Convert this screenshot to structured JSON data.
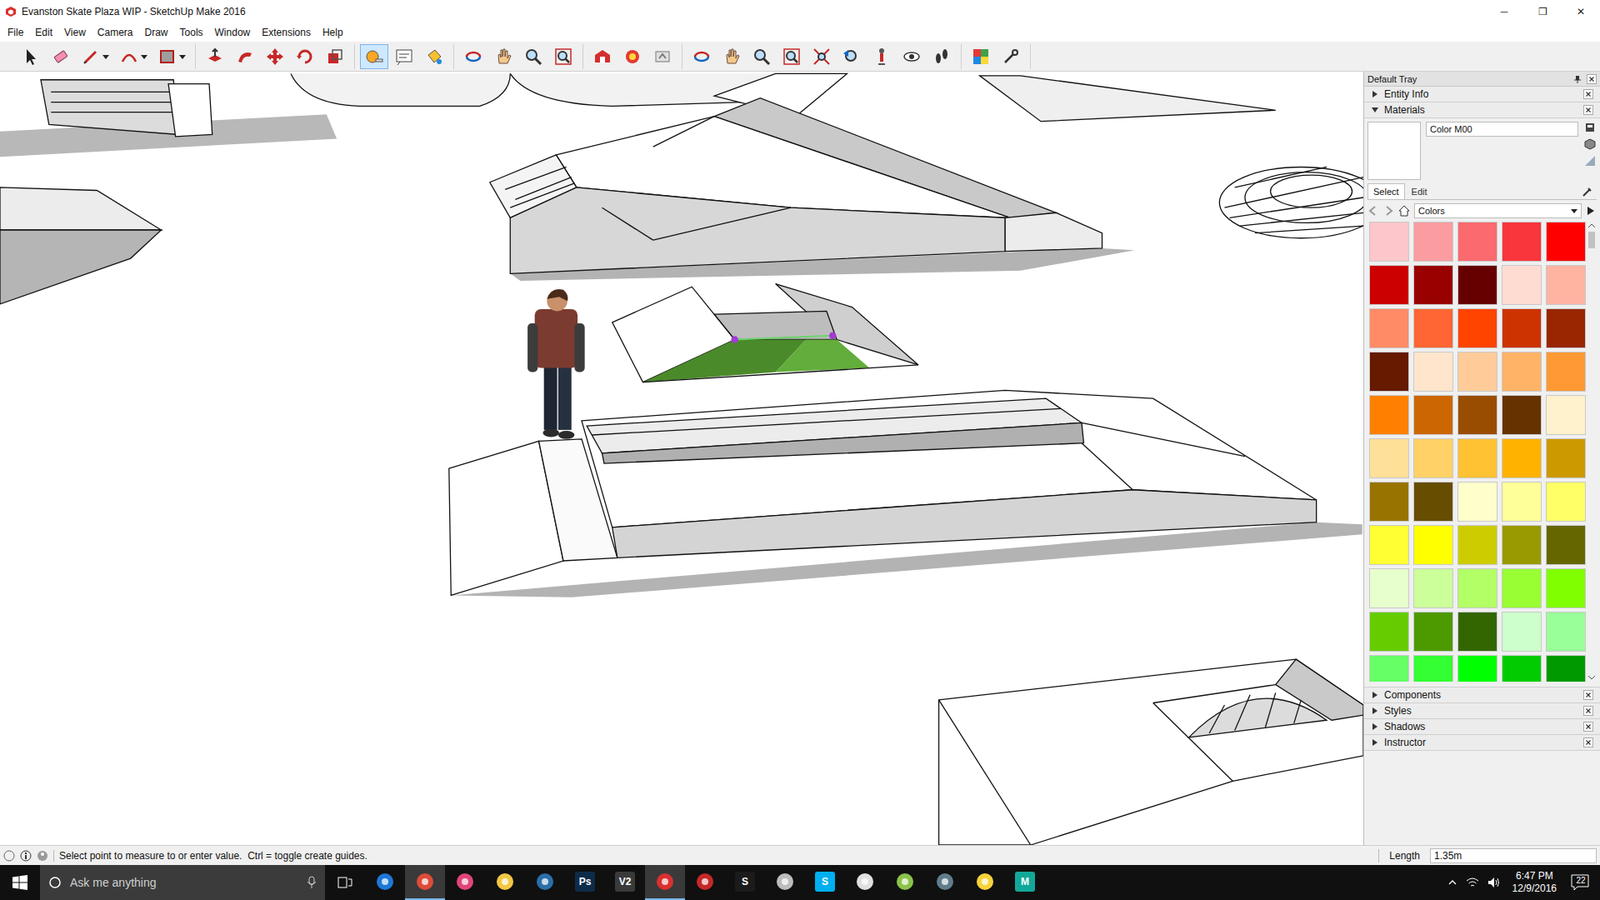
{
  "window": {
    "title": "Evanston Skate Plaza WIP - SketchUp Make 2016",
    "controls": [
      "─",
      "❐",
      "✕"
    ]
  },
  "menu": [
    "File",
    "Edit",
    "View",
    "Camera",
    "Draw",
    "Tools",
    "Window",
    "Extensions",
    "Help"
  ],
  "toolbar": [
    [
      {
        "kind": "select",
        "selected": false,
        "menu": false
      },
      {
        "kind": "eraser",
        "selected": false,
        "menu": false
      },
      {
        "kind": "pencil",
        "selected": false,
        "menu": true
      },
      {
        "kind": "arc",
        "selected": false,
        "menu": true
      },
      {
        "kind": "rectangle",
        "selected": false,
        "menu": true
      }
    ],
    [
      {
        "kind": "pushpull",
        "selected": false,
        "menu": false
      },
      {
        "kind": "followme",
        "selected": false,
        "menu": false
      },
      {
        "kind": "move",
        "selected": false,
        "menu": false
      },
      {
        "kind": "rotate",
        "selected": false,
        "menu": false
      },
      {
        "kind": "scale",
        "selected": false,
        "menu": false
      }
    ],
    [
      {
        "kind": "tape",
        "selected": true,
        "menu": false
      },
      {
        "kind": "text",
        "selected": false,
        "menu": false
      },
      {
        "kind": "paint",
        "selected": false,
        "menu": false
      }
    ],
    [
      {
        "kind": "orbit",
        "selected": false,
        "menu": false
      },
      {
        "kind": "pan",
        "selected": false,
        "menu": false
      },
      {
        "kind": "zoom",
        "selected": false,
        "menu": false
      },
      {
        "kind": "zoomwindow",
        "selected": false,
        "menu": false
      }
    ],
    [
      {
        "kind": "warehouse",
        "selected": false,
        "menu": false
      },
      {
        "kind": "extensions",
        "selected": false,
        "menu": false
      },
      {
        "kind": "share",
        "selected": false,
        "menu": false
      }
    ],
    [
      {
        "kind": "orbit",
        "selected": false,
        "menu": false
      },
      {
        "kind": "pan",
        "selected": false,
        "menu": false
      },
      {
        "kind": "zoom",
        "selected": false,
        "menu": false
      },
      {
        "kind": "zoomwindow",
        "selected": false,
        "menu": false
      },
      {
        "kind": "zoomextents",
        "selected": false,
        "menu": false
      },
      {
        "kind": "previous",
        "selected": false,
        "menu": false
      },
      {
        "kind": "position",
        "selected": false,
        "menu": false
      },
      {
        "kind": "lookaround",
        "selected": false,
        "menu": false
      },
      {
        "kind": "walk",
        "selected": false,
        "menu": false
      }
    ],
    [
      {
        "kind": "colors",
        "selected": false,
        "menu": false
      },
      {
        "kind": "extra",
        "selected": false,
        "menu": false
      }
    ]
  ],
  "tray": {
    "title": "Default Tray",
    "sections_top": [
      {
        "label": "Entity Info",
        "expanded": false
      },
      {
        "label": "Materials",
        "expanded": true
      }
    ],
    "materials": {
      "name": "Color M00",
      "tabs": [
        {
          "label": "Select",
          "selected": true
        },
        {
          "label": "Edit",
          "selected": false
        }
      ],
      "library": "Colors",
      "swatches": [
        {
          "color": "#fcc6ca"
        },
        {
          "color": "#fb9ca0"
        },
        {
          "color": "#fa6a6e"
        },
        {
          "color": "#f8363b"
        },
        {
          "color": "#ff0000"
        },
        {
          "color": "#cc0000"
        },
        {
          "color": "#990000"
        },
        {
          "color": "#660000"
        },
        {
          "color": "#ffdcd2"
        },
        {
          "color": "#ffb4a2"
        },
        {
          "color": "#ff8a66"
        },
        {
          "color": "#ff6633"
        },
        {
          "color": "#ff4400"
        },
        {
          "color": "#cc3300"
        },
        {
          "color": "#992600"
        },
        {
          "color": "#661a00"
        },
        {
          "color": "#ffe5cc"
        },
        {
          "color": "#ffcc99"
        },
        {
          "color": "#ffb366"
        },
        {
          "color": "#ff9933"
        },
        {
          "color": "#ff8000"
        },
        {
          "color": "#cc6600"
        },
        {
          "color": "#994d00"
        },
        {
          "color": "#663300"
        },
        {
          "color": "#fff2cc"
        },
        {
          "color": "#ffe099"
        },
        {
          "color": "#ffd166"
        },
        {
          "color": "#ffc233"
        },
        {
          "color": "#ffb300"
        },
        {
          "color": "#cc9900"
        },
        {
          "color": "#997300"
        },
        {
          "color": "#664d00"
        },
        {
          "color": "#ffffcc"
        },
        {
          "color": "#ffff99"
        },
        {
          "color": "#ffff66"
        },
        {
          "color": "#ffff33"
        },
        {
          "color": "#ffff00"
        },
        {
          "color": "#cccc00"
        },
        {
          "color": "#999900"
        },
        {
          "color": "#666600"
        },
        {
          "color": "#e6ffcc"
        },
        {
          "color": "#ccff99"
        },
        {
          "color": "#b3ff66"
        },
        {
          "color": "#99ff33"
        },
        {
          "color": "#80ff00"
        },
        {
          "color": "#66cc00"
        },
        {
          "color": "#4d9900"
        },
        {
          "color": "#336600"
        },
        {
          "color": "#ccffcc"
        },
        {
          "color": "#99ff99"
        },
        {
          "color": "#66ff66"
        },
        {
          "color": "#33ff33"
        },
        {
          "color": "#00ff00"
        },
        {
          "color": "#00cc00"
        },
        {
          "color": "#009900"
        }
      ]
    },
    "sections_bottom": [
      {
        "label": "Components",
        "expanded": false
      },
      {
        "label": "Styles",
        "expanded": false
      },
      {
        "label": "Shadows",
        "expanded": false
      },
      {
        "label": "Instructor",
        "expanded": false
      }
    ]
  },
  "status_bar": {
    "message": "Select point to measure to or enter value.  Ctrl = toggle create guides.",
    "measure_label": "Length",
    "measure_value": "1.35m"
  },
  "taskbar": {
    "search_placeholder": "Ask me anything",
    "apps": [
      {
        "kind": "icon",
        "glyph": "",
        "color": "#1e78d7",
        "active": false
      },
      {
        "kind": "icon",
        "glyph": "",
        "color": "#dd4b39",
        "active": true
      },
      {
        "kind": "icon",
        "glyph": "",
        "color": "#e0457b",
        "active": false
      },
      {
        "kind": "icon",
        "glyph": "",
        "color": "#f2c744",
        "active": false
      },
      {
        "kind": "icon",
        "glyph": "",
        "color": "#2a6fa8",
        "active": false
      },
      {
        "kind": "glyph",
        "glyph": "Ps",
        "color": "#0d2c4a",
        "active": false
      },
      {
        "kind": "glyph",
        "glyph": "V2",
        "color": "#3a3a3a",
        "active": false
      },
      {
        "kind": "icon",
        "glyph": "",
        "color": "#d9302f",
        "active": true
      },
      {
        "kind": "icon",
        "glyph": "",
        "color": "#c62828",
        "active": false
      },
      {
        "kind": "glyph",
        "glyph": "S",
        "color": "#1b1b1b",
        "active": false
      },
      {
        "kind": "icon",
        "glyph": "",
        "color": "#bdbdbd",
        "active": false
      },
      {
        "kind": "glyph",
        "glyph": "S",
        "color": "#00aff0",
        "active": false
      },
      {
        "kind": "icon",
        "glyph": "",
        "color": "#e0e0e0",
        "active": false
      },
      {
        "kind": "icon",
        "glyph": "",
        "color": "#8bc34a",
        "active": false
      },
      {
        "kind": "icon",
        "glyph": "",
        "color": "#607d8b",
        "active": false
      },
      {
        "kind": "icon",
        "glyph": "",
        "color": "#f5d33a",
        "active": false
      },
      {
        "kind": "glyph",
        "glyph": "M",
        "color": "#11a89a",
        "active": false
      }
    ],
    "time": "6:47 PM",
    "date": "12/9/2016",
    "notifications": "22"
  }
}
